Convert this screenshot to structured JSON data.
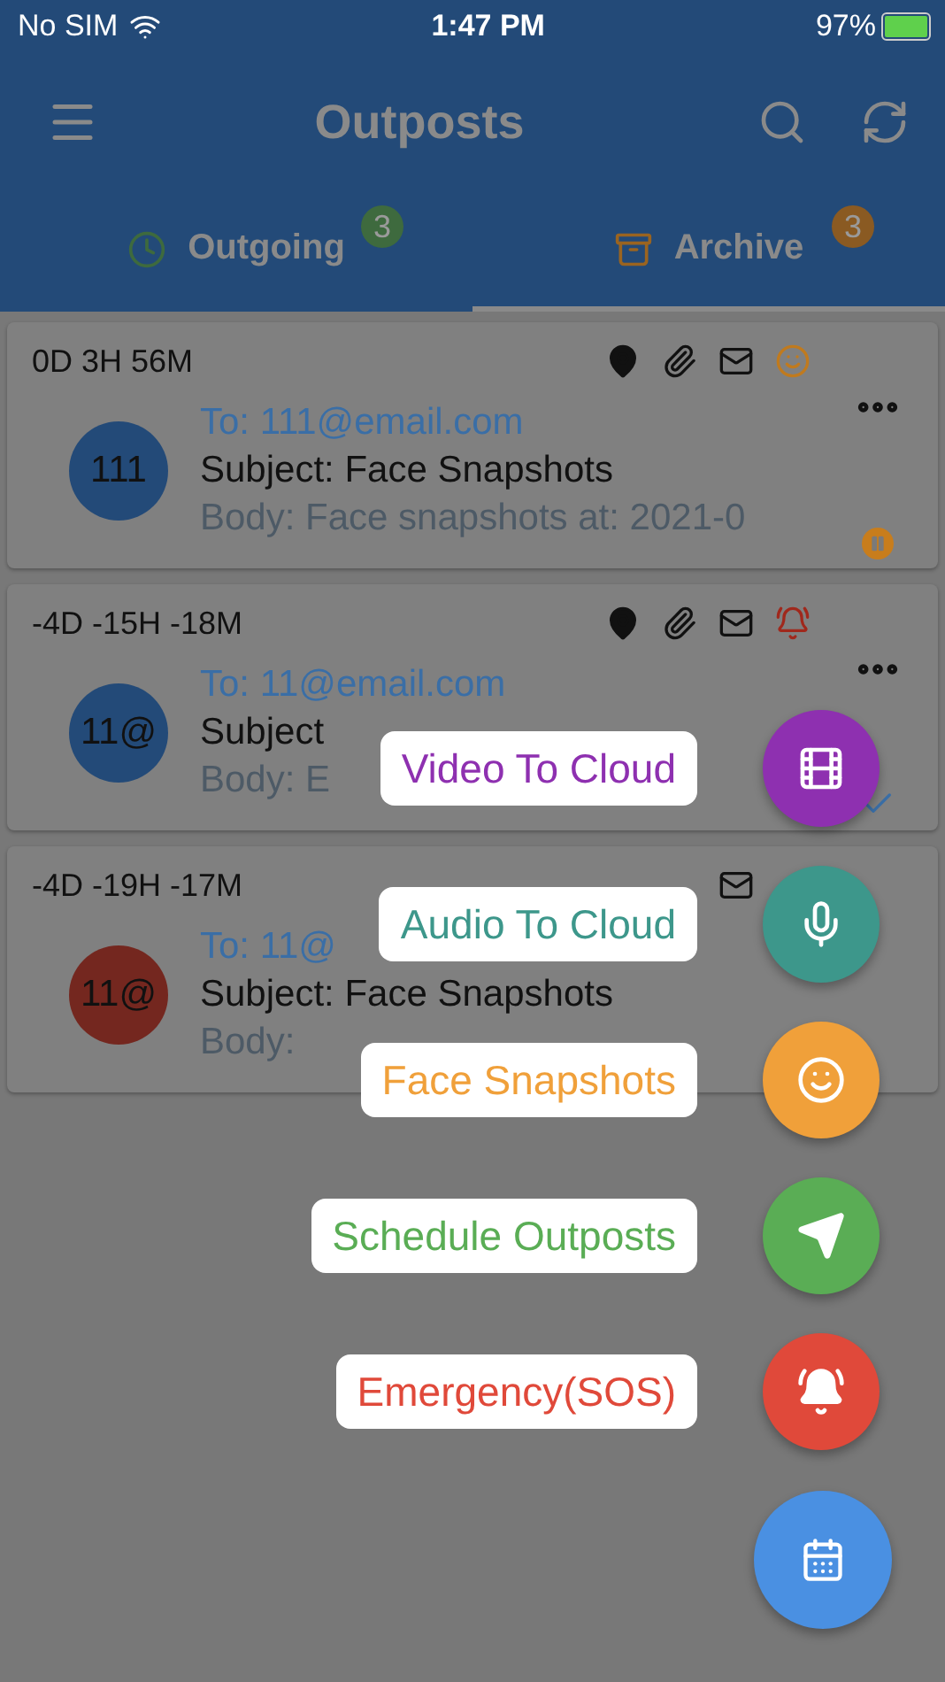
{
  "status_bar": {
    "carrier": "No SIM",
    "time": "1:47 PM",
    "battery": "97%"
  },
  "app_bar": {
    "title": "Outposts"
  },
  "tabs": [
    {
      "kind": "outgoing",
      "label": "Outgoing",
      "count": "3",
      "selected": false
    },
    {
      "kind": "archive",
      "label": "Archive",
      "count": "3",
      "selected": true
    }
  ],
  "outposts": [
    {
      "countdown": "0D 3H 56M",
      "icons": [
        {
          "kind": "location"
        },
        {
          "kind": "attachment"
        },
        {
          "kind": "mail"
        },
        {
          "kind": "face"
        }
      ],
      "to": "To: 111@email.com",
      "subject": "Subject: Face Snapshots",
      "body": "Body: Face snapshots at: 2021-0",
      "avatar": "111",
      "color": "#234a78",
      "more_button": true,
      "status": {
        "kind": "paused"
      }
    },
    {
      "countdown": "-4D -15H -18M",
      "icons": [
        {
          "kind": "location"
        },
        {
          "kind": "attachment"
        },
        {
          "kind": "mail"
        },
        {
          "kind": "sos"
        }
      ],
      "to": "To: 11@email.com",
      "subject": "Subject",
      "body": "Body: E",
      "avatar": "11@",
      "color": "#234a78",
      "more_button": true,
      "status": {
        "kind": "sent"
      }
    },
    {
      "countdown": "-4D -19H -17M",
      "icons": [
        {
          "kind": "mail"
        }
      ],
      "to": "To: 11@",
      "subject": "Subject: Face Snapshots",
      "body": "Body: ",
      "avatar": "11@",
      "color": "#74271f",
      "more_button": false
    }
  ],
  "speed_dial": [
    {
      "kind": "video",
      "label": "Video To Cloud",
      "color": "#8e30b0"
    },
    {
      "kind": "audio",
      "label": "Audio To Cloud",
      "color": "#3d978b"
    },
    {
      "kind": "face",
      "label": "Face Snapshots",
      "color": "#f0a03a"
    },
    {
      "kind": "schedule",
      "label": "Schedule Outposts",
      "color": "#5aad55"
    },
    {
      "kind": "sos",
      "label": "Emergency(SOS)",
      "color": "#e0493a"
    }
  ]
}
